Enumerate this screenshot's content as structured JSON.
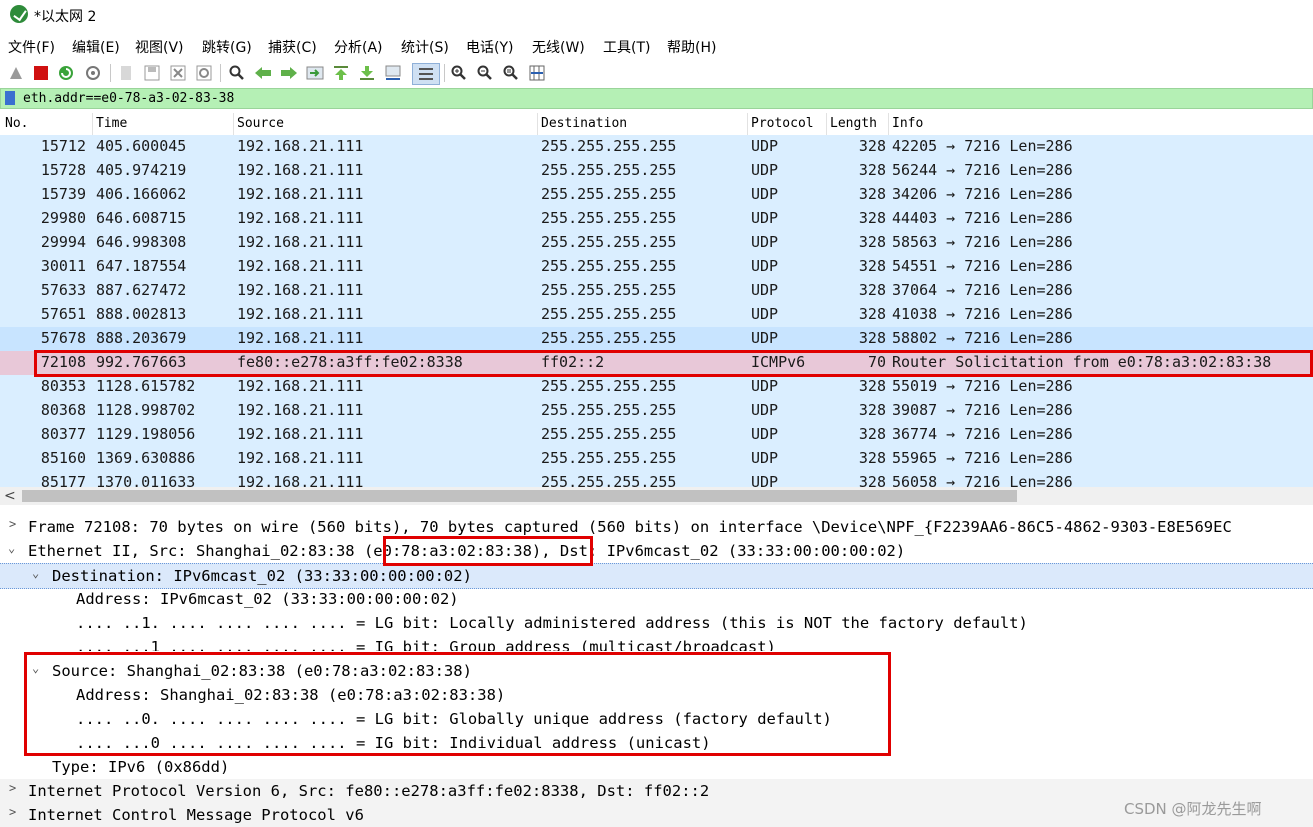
{
  "window": {
    "title": "*以太网 2"
  },
  "menu": [
    "文件(F)",
    "编辑(E)",
    "视图(V)",
    "跳转(G)",
    "捕获(C)",
    "分析(A)",
    "统计(S)",
    "电话(Y)",
    "无线(W)",
    "工具(T)",
    "帮助(H)"
  ],
  "filter": {
    "value": "eth.addr==e0-78-a3-02-83-38"
  },
  "columns": [
    "No.",
    "Time",
    "Source",
    "Destination",
    "Protocol",
    "Length",
    "Info"
  ],
  "packets": [
    {
      "no": "15712",
      "time": "405.600045",
      "src": "192.168.21.111",
      "dst": "255.255.255.255",
      "proto": "UDP",
      "len": "328",
      "info": "42205 → 7216 Len=286"
    },
    {
      "no": "15728",
      "time": "405.974219",
      "src": "192.168.21.111",
      "dst": "255.255.255.255",
      "proto": "UDP",
      "len": "328",
      "info": "56244 → 7216 Len=286"
    },
    {
      "no": "15739",
      "time": "406.166062",
      "src": "192.168.21.111",
      "dst": "255.255.255.255",
      "proto": "UDP",
      "len": "328",
      "info": "34206 → 7216 Len=286"
    },
    {
      "no": "29980",
      "time": "646.608715",
      "src": "192.168.21.111",
      "dst": "255.255.255.255",
      "proto": "UDP",
      "len": "328",
      "info": "44403 → 7216 Len=286"
    },
    {
      "no": "29994",
      "time": "646.998308",
      "src": "192.168.21.111",
      "dst": "255.255.255.255",
      "proto": "UDP",
      "len": "328",
      "info": "58563 → 7216 Len=286"
    },
    {
      "no": "30011",
      "time": "647.187554",
      "src": "192.168.21.111",
      "dst": "255.255.255.255",
      "proto": "UDP",
      "len": "328",
      "info": "54551 → 7216 Len=286"
    },
    {
      "no": "57633",
      "time": "887.627472",
      "src": "192.168.21.111",
      "dst": "255.255.255.255",
      "proto": "UDP",
      "len": "328",
      "info": "37064 → 7216 Len=286"
    },
    {
      "no": "57651",
      "time": "888.002813",
      "src": "192.168.21.111",
      "dst": "255.255.255.255",
      "proto": "UDP",
      "len": "328",
      "info": "41038 → 7216 Len=286"
    },
    {
      "no": "57678",
      "time": "888.203679",
      "src": "192.168.21.111",
      "dst": "255.255.255.255",
      "proto": "UDP",
      "len": "328",
      "info": "58802 → 7216 Len=286"
    },
    {
      "no": "72108",
      "time": "992.767663",
      "src": "fe80::e278:a3ff:fe02:8338",
      "dst": "ff02::2",
      "proto": "ICMPv6",
      "len": "70",
      "info": "Router Solicitation from e0:78:a3:02:83:38"
    },
    {
      "no": "80353",
      "time": "1128.615782",
      "src": "192.168.21.111",
      "dst": "255.255.255.255",
      "proto": "UDP",
      "len": "328",
      "info": "55019 → 7216 Len=286"
    },
    {
      "no": "80368",
      "time": "1128.998702",
      "src": "192.168.21.111",
      "dst": "255.255.255.255",
      "proto": "UDP",
      "len": "328",
      "info": "39087 → 7216 Len=286"
    },
    {
      "no": "80377",
      "time": "1129.198056",
      "src": "192.168.21.111",
      "dst": "255.255.255.255",
      "proto": "UDP",
      "len": "328",
      "info": "36774 → 7216 Len=286"
    },
    {
      "no": "85160",
      "time": "1369.630886",
      "src": "192.168.21.111",
      "dst": "255.255.255.255",
      "proto": "UDP",
      "len": "328",
      "info": "55965 → 7216 Len=286"
    },
    {
      "no": "85177",
      "time": "1370.011633",
      "src": "192.168.21.111",
      "dst": "255.255.255.255",
      "proto": "UDP",
      "len": "328",
      "info": "56058 → 7216 Len=286"
    }
  ],
  "details": {
    "frame": "Frame 72108: 70 bytes on wire (560 bits), 70 bytes captured (560 bits) on interface \\Device\\NPF_{F2239AA6-86C5-4862-9303-E8E569EC",
    "ethernet": "Ethernet II, Src: Shanghai_02:83:38 (e0:78:a3:02:83:38), Dst: IPv6mcast_02 (33:33:00:00:00:02)",
    "destination": "Destination: IPv6mcast_02 (33:33:00:00:00:02)",
    "dst_address": "Address: IPv6mcast_02 (33:33:00:00:00:02)",
    "dst_lg": ".... ..1. .... .... .... .... = LG bit: Locally administered address (this is NOT the factory default)",
    "dst_ig": ".... ...1 .... .... .... .... = IG bit: Group address (multicast/broadcast)",
    "source": "Source: Shanghai_02:83:38 (e0:78:a3:02:83:38)",
    "src_address": "Address: Shanghai_02:83:38 (e0:78:a3:02:83:38)",
    "src_lg": ".... ..0. .... .... .... .... = LG bit: Globally unique address (factory default)",
    "src_ig": ".... ...0 .... .... .... .... = IG bit: Individual address (unicast)",
    "type": "Type: IPv6 (0x86dd)",
    "ipv6": "Internet Protocol Version 6, Src: fe80::e278:a3ff:fe02:8338, Dst: ff02::2",
    "icmpv6": "Internet Control Message Protocol v6"
  },
  "watermark": "CSDN @阿龙先生啊",
  "colors": {
    "row_bg": "#daeeff",
    "row_selected": "#e8c8d8",
    "filter_ok": "#b5f0b5",
    "highlight": "#e00000"
  }
}
